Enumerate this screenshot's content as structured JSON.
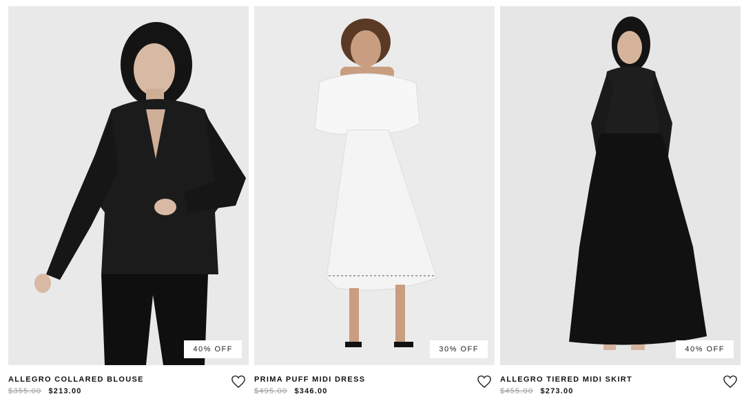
{
  "products": [
    {
      "name": "ALLEGRO COLLARED BLOUSE",
      "original_price": "$355.00",
      "sale_price": "$213.00",
      "discount_badge": "40% OFF",
      "wishlist_icon": "heart-icon",
      "image": "model-black-satin-blouse"
    },
    {
      "name": "PRIMA PUFF MIDI DRESS",
      "original_price": "$495.00",
      "sale_price": "$346.00",
      "discount_badge": "30% OFF",
      "wishlist_icon": "heart-icon",
      "image": "model-white-puff-midi-dress"
    },
    {
      "name": "ALLEGRO TIERED MIDI SKIRT",
      "original_price": "$455.00",
      "sale_price": "$273.00",
      "discount_badge": "40% OFF",
      "wishlist_icon": "heart-icon",
      "image": "model-black-tiered-skirt"
    }
  ],
  "colors": {
    "photo_background": "#ececec",
    "strikethrough_price": "#9a9a9a",
    "text": "#111111"
  }
}
